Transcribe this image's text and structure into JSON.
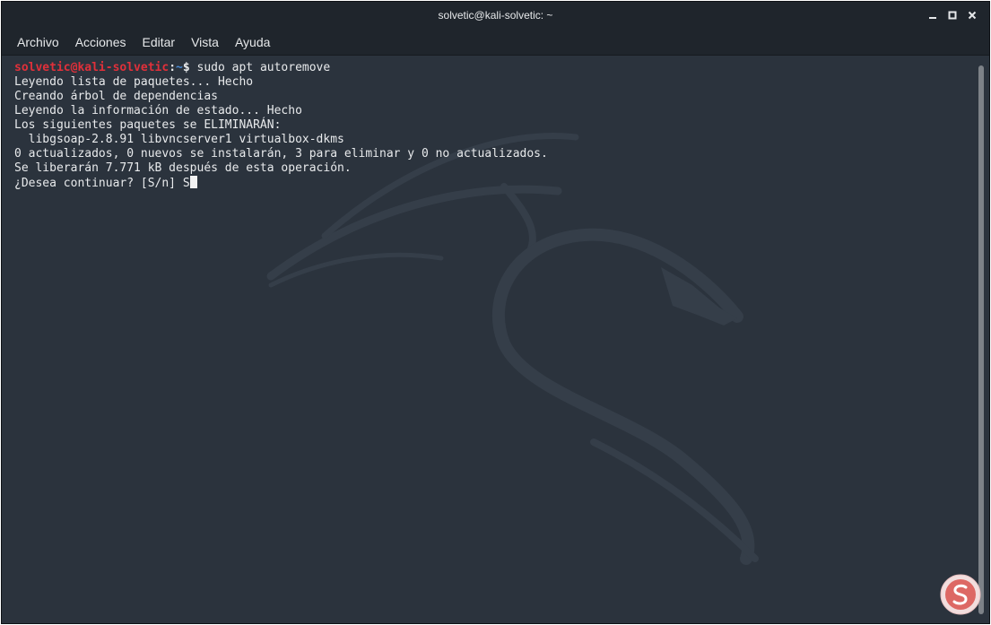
{
  "window": {
    "title": "solvetic@kali-solvetic: ~",
    "controls": {
      "minimize": "minimize-icon",
      "maximize": "maximize-icon",
      "close": "close-icon"
    }
  },
  "menubar": {
    "items": [
      "Archivo",
      "Acciones",
      "Editar",
      "Vista",
      "Ayuda"
    ]
  },
  "terminal": {
    "prompt": {
      "user_host": "solvetic@kali-solvetic",
      "sep": ":",
      "path": "~",
      "symbol": "$",
      "command": " sudo apt autoremove"
    },
    "lines": [
      "Leyendo lista de paquetes... Hecho",
      "Creando árbol de dependencias",
      "Leyendo la información de estado... Hecho",
      "Los siguientes paquetes se ELIMINARÁN:",
      "  libgsoap-2.8.91 libvncserver1 virtualbox-dkms",
      "0 actualizados, 0 nuevos se instalarán, 3 para eliminar y 0 no actualizados.",
      "Se liberarán 7.771 kB después de esta operación."
    ],
    "question": "¿Desea continuar? [S/n] S"
  },
  "colors": {
    "background": "#2b333d",
    "prompt_user": "#e0303a",
    "prompt_path": "#4a8bd6"
  },
  "icons": {
    "background_logo": "kali-dragon-icon",
    "watermark": "solvetic-logo-icon"
  }
}
